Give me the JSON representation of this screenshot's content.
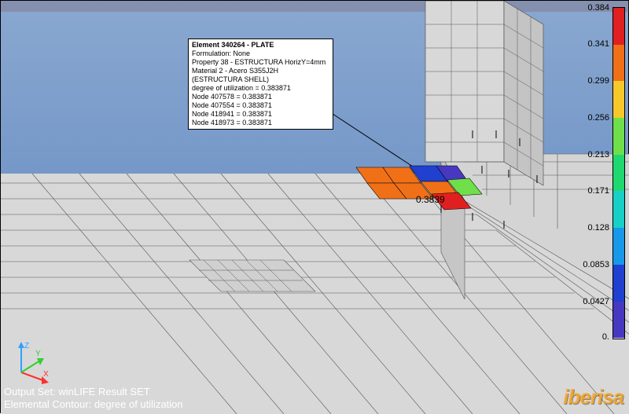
{
  "tooltip": {
    "title": "Element 340264 - PLATE",
    "lines": [
      "Formulation: None",
      "Property 38 - ESTRUCTURA HorizY=4mm",
      "Material 2 - Acero S355J2H (ESTRUCTURA SHELL)",
      "degree of utilization = 0.383871",
      "Node 407578 = 0.383871",
      "Node 407554 = 0.383871",
      "Node 418941 = 0.383871",
      "Node 418973 = 0.383871"
    ]
  },
  "annotation_value": "0.3839",
  "axes": {
    "x": "X",
    "y": "Y",
    "z": "Z"
  },
  "footer": {
    "output_set": "Output Set: winLIFE Result SET",
    "contour": "Elemental Contour: degree of utilization"
  },
  "logo": "iberisa",
  "legend": {
    "ticks": [
      "0.384",
      "0.341",
      "0.299",
      "0.256",
      "0.213",
      "0.171",
      "0.128",
      "0.0853",
      "0.0427",
      "0."
    ],
    "colors": [
      "#e02020",
      "#f07018",
      "#f7c82a",
      "#6fe04a",
      "#1fd870",
      "#18d0c8",
      "#1898e8",
      "#2040d0",
      "#4838c0"
    ]
  },
  "chart_data": {
    "type": "heatmap",
    "title": "Elemental Contour: degree of utilization",
    "value_label": "degree of utilization",
    "range": [
      0.0,
      0.384
    ],
    "highlighted_element": {
      "id": 340264,
      "value": 0.383871
    },
    "color_stops": [
      {
        "value": 0.384,
        "color": "#e02020"
      },
      {
        "value": 0.341,
        "color": "#f07018"
      },
      {
        "value": 0.299,
        "color": "#f7c82a"
      },
      {
        "value": 0.256,
        "color": "#6fe04a"
      },
      {
        "value": 0.213,
        "color": "#1fd870"
      },
      {
        "value": 0.171,
        "color": "#18d0c8"
      },
      {
        "value": 0.128,
        "color": "#1898e8"
      },
      {
        "value": 0.0853,
        "color": "#2040d0"
      },
      {
        "value": 0.0427,
        "color": "#4838c0"
      },
      {
        "value": 0.0,
        "color": "#4838c0"
      }
    ]
  }
}
